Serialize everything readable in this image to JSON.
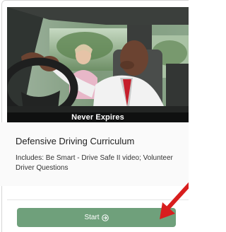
{
  "card": {
    "image_caption": "Never Expires",
    "title": "Defensive Driving Curriculum",
    "description": "Includes: Be Smart - Drive Safe II video; Volunteer Driver Questions",
    "start_button_label": "Start",
    "start_icon": "arrow-circle-right-icon"
  },
  "colors": {
    "button": "#6fa07b",
    "annotation_arrow": "#d81e1e"
  }
}
